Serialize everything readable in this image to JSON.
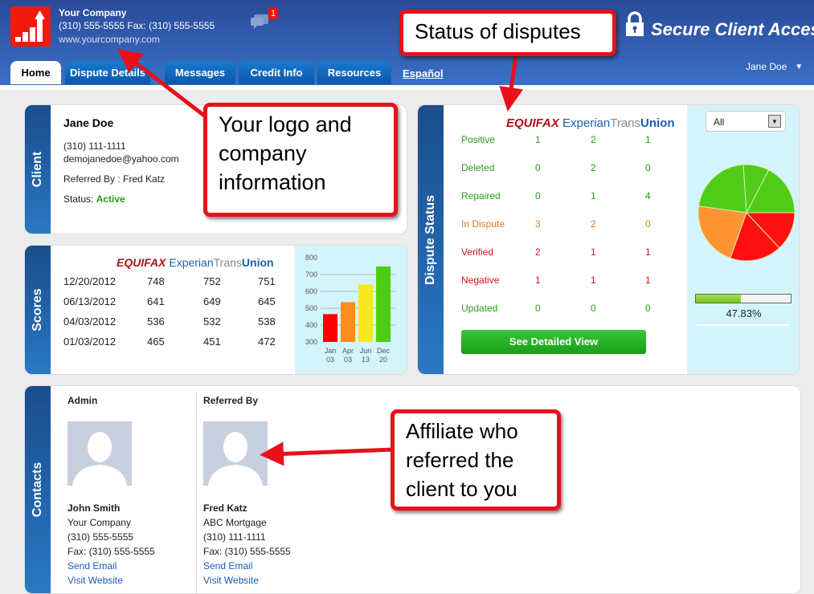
{
  "header": {
    "company": "Your Company",
    "phone_line": "(310) 555-5555  Fax: (310) 555-5555",
    "website": "www.yourcompany.com",
    "message_count": "1",
    "secure_title": "Secure Client Access",
    "user": "Jane Doe"
  },
  "tabs": [
    {
      "label": "Home",
      "active": true
    },
    {
      "label": "Dispute Details"
    },
    {
      "label": "Messages"
    },
    {
      "label": "Credit Info"
    },
    {
      "label": "Resources"
    }
  ],
  "language_link": "Español",
  "client": {
    "section": "Client",
    "name": "Jane Doe",
    "phone": "(310) 111-1111",
    "email": "demojanedoe@yahoo.com",
    "referred": "Referred By : Fred Katz",
    "status_label": "Status:",
    "status": "Active"
  },
  "bureaus": {
    "equifax": "EQUIFAX",
    "experian": "Experian",
    "transunion_a": "Trans",
    "transunion_b": "Union"
  },
  "scores": {
    "section": "Scores",
    "rows": [
      [
        "12/20/2012",
        "748",
        "752",
        "751"
      ],
      [
        "06/13/2012",
        "641",
        "649",
        "645"
      ],
      [
        "04/03/2012",
        "536",
        "532",
        "538"
      ],
      [
        "01/03/2012",
        "465",
        "451",
        "472"
      ]
    ]
  },
  "chart_data": {
    "type": "bar",
    "categories": [
      "Jan 03",
      "Apr 03",
      "Jun 13",
      "Dec 20"
    ],
    "cat_lines": [
      [
        "Jan",
        "03"
      ],
      [
        "Apr",
        "03"
      ],
      [
        "Jun",
        "13"
      ],
      [
        "Dec",
        "20"
      ]
    ],
    "values": [
      465,
      536,
      641,
      748
    ],
    "colors": [
      "#ff0000",
      "#ff8c20",
      "#f8e820",
      "#50cc10"
    ],
    "ylim": [
      300,
      800
    ],
    "yticks": [
      "300",
      "400",
      "500",
      "600",
      "700",
      "800"
    ]
  },
  "dispute": {
    "section": "Dispute Status",
    "filter": "All",
    "rows": [
      {
        "label": "Positive",
        "vals": [
          "1",
          "2",
          "1"
        ],
        "cls": "green"
      },
      {
        "label": "Deleted",
        "vals": [
          "0",
          "2",
          "0"
        ],
        "cls": "green"
      },
      {
        "label": "Repaired",
        "vals": [
          "0",
          "1",
          "4"
        ],
        "cls": "green"
      },
      {
        "label": "In Dispute",
        "vals": [
          "3",
          "2",
          "0"
        ],
        "cls": "orange"
      },
      {
        "label": "Verified",
        "vals": [
          "2",
          "1",
          "1"
        ],
        "cls": "red"
      },
      {
        "label": "Negative",
        "vals": [
          "1",
          "1",
          "1"
        ],
        "cls": "red"
      },
      {
        "label": "Updated",
        "vals": [
          "0",
          "0",
          "0"
        ],
        "cls": "green"
      }
    ],
    "button": "See Detailed View",
    "progress": 47.83,
    "progress_label": "47.83%",
    "pie": {
      "values": [
        4,
        2,
        5,
        5,
        4,
        3
      ],
      "colors": [
        "#50cc18",
        "#50cc18",
        "#50cc18",
        "#ff9430",
        "#ff1010",
        "#ff1010"
      ]
    }
  },
  "contacts": {
    "section": "Contacts",
    "people": [
      {
        "role": "Admin",
        "name": "John Smith",
        "company": "Your Company",
        "phone": "(310) 555-5555",
        "fax": "Fax: (310) 555-5555",
        "email": "Send Email",
        "web": "Visit Website"
      },
      {
        "role": "Referred By",
        "name": "Fred Katz",
        "company": "ABC Mortgage",
        "phone": "(310) 111-1111",
        "fax": "Fax: (310) 555-5555",
        "email": "Send Email",
        "web": "Visit Website"
      }
    ]
  },
  "callouts": {
    "status": "Status of disputes",
    "logo": "Your logo and company information",
    "affiliate": "Affiliate who referred the client to you"
  }
}
